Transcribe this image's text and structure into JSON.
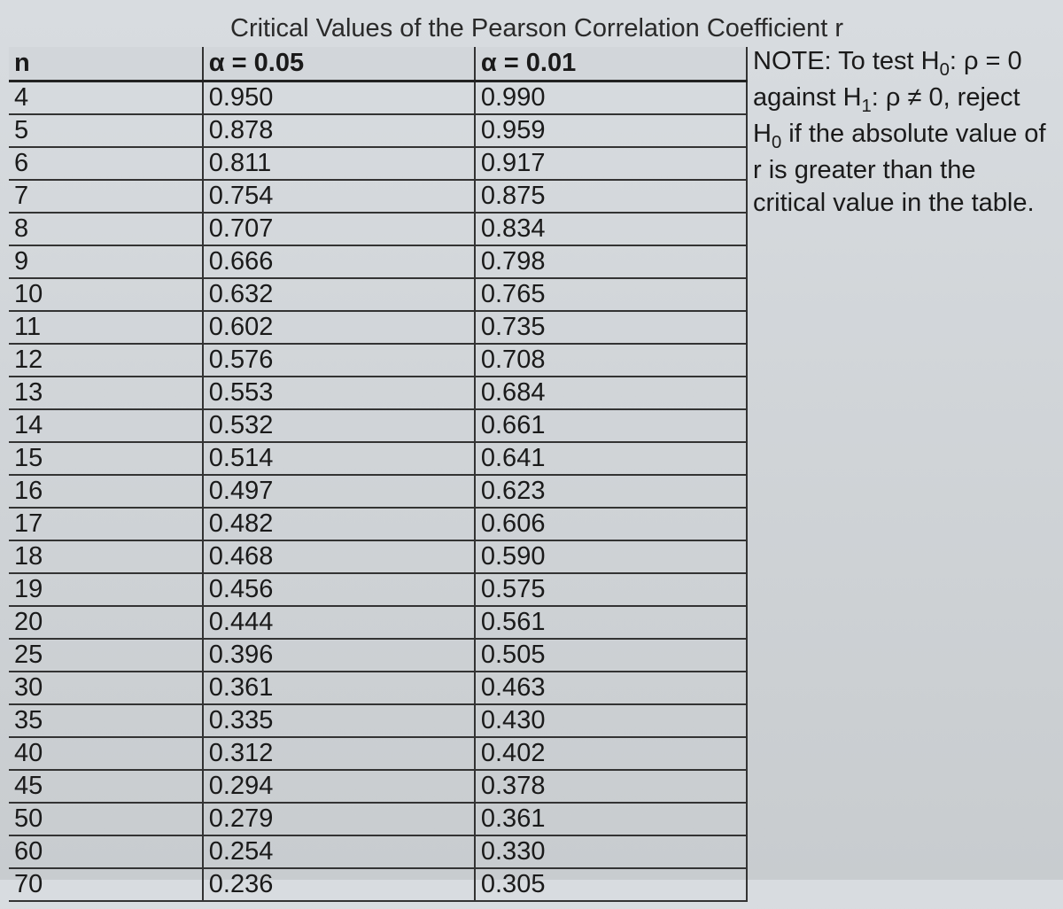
{
  "title": "Critical Values of the Pearson Correlation Coefficient r",
  "headers": {
    "n": "n",
    "alpha05": "α = 0.05",
    "alpha01": "α = 0.01"
  },
  "note": {
    "line1_prefix": "NOTE: To test H",
    "line1_sub": "0",
    "line1_suffix": ": ρ = 0",
    "line2_prefix": "against H",
    "line2_sub": "1",
    "line2_mid": ": ρ ≠ 0, reject H",
    "line2_sub2": "0",
    "line3": "if the absolute value of r is",
    "line4": "greater than the critical",
    "line5": "value in the table."
  },
  "rows": [
    {
      "n": "4",
      "a05": "0.950",
      "a01": "0.990"
    },
    {
      "n": "5",
      "a05": "0.878",
      "a01": "0.959"
    },
    {
      "n": "6",
      "a05": "0.811",
      "a01": "0.917"
    },
    {
      "n": "7",
      "a05": "0.754",
      "a01": "0.875"
    },
    {
      "n": "8",
      "a05": "0.707",
      "a01": "0.834"
    },
    {
      "n": "9",
      "a05": "0.666",
      "a01": "0.798"
    },
    {
      "n": "10",
      "a05": "0.632",
      "a01": "0.765"
    },
    {
      "n": "11",
      "a05": "0.602",
      "a01": "0.735"
    },
    {
      "n": "12",
      "a05": "0.576",
      "a01": "0.708"
    },
    {
      "n": "13",
      "a05": "0.553",
      "a01": "0.684"
    },
    {
      "n": "14",
      "a05": "0.532",
      "a01": "0.661"
    },
    {
      "n": "15",
      "a05": "0.514",
      "a01": "0.641"
    },
    {
      "n": "16",
      "a05": "0.497",
      "a01": "0.623"
    },
    {
      "n": "17",
      "a05": "0.482",
      "a01": "0.606"
    },
    {
      "n": "18",
      "a05": "0.468",
      "a01": "0.590"
    },
    {
      "n": "19",
      "a05": "0.456",
      "a01": "0.575"
    },
    {
      "n": "20",
      "a05": "0.444",
      "a01": "0.561"
    },
    {
      "n": "25",
      "a05": "0.396",
      "a01": "0.505"
    },
    {
      "n": "30",
      "a05": "0.361",
      "a01": "0.463"
    },
    {
      "n": "35",
      "a05": "0.335",
      "a01": "0.430"
    },
    {
      "n": "40",
      "a05": "0.312",
      "a01": "0.402"
    },
    {
      "n": "45",
      "a05": "0.294",
      "a01": "0.378"
    },
    {
      "n": "50",
      "a05": "0.279",
      "a01": "0.361"
    },
    {
      "n": "60",
      "a05": "0.254",
      "a01": "0.330"
    },
    {
      "n": "70",
      "a05": "0.236",
      "a01": "0.305"
    }
  ]
}
